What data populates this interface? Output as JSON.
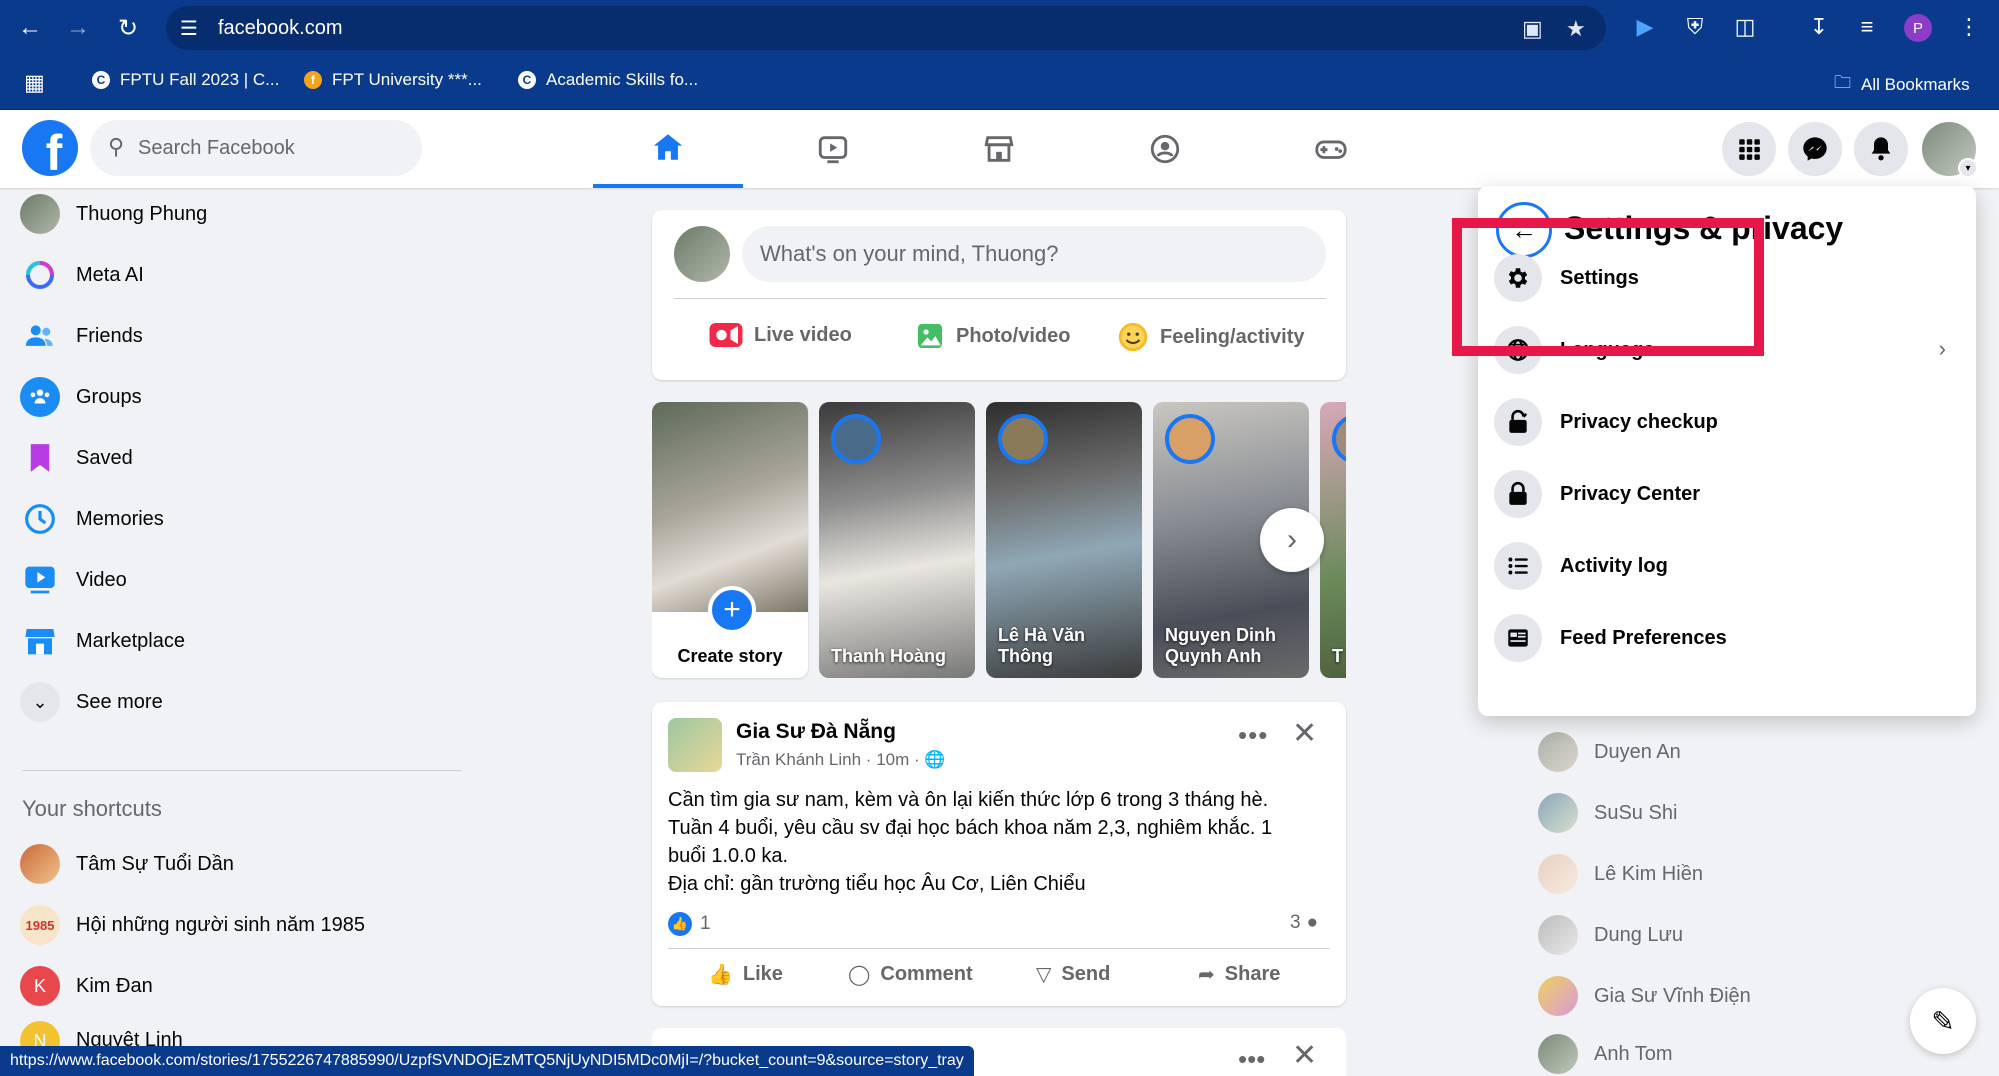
{
  "browser": {
    "url": "facebook.com",
    "profile_initial": "P",
    "bookmarks": [
      {
        "label": "FPTU Fall 2023 | C..."
      },
      {
        "label": "FPT University ***..."
      },
      {
        "label": "Academic Skills fo..."
      }
    ],
    "all_bookmarks": "All Bookmarks",
    "status_url": "https://www.facebook.com/stories/1755226747885990/UzpfSVNDOjEzMTQ5NjUyNDI5MDc0MjI=/?bucket_count=9&source=story_tray"
  },
  "header": {
    "search_placeholder": "Search Facebook",
    "logo_letter": "f"
  },
  "sidebar": {
    "items": [
      {
        "label": "Thuong Phung"
      },
      {
        "label": "Meta AI"
      },
      {
        "label": "Friends"
      },
      {
        "label": "Groups"
      },
      {
        "label": "Saved"
      },
      {
        "label": "Memories"
      },
      {
        "label": "Video"
      },
      {
        "label": "Marketplace"
      },
      {
        "label": "See more"
      }
    ],
    "shortcuts_heading": "Your shortcuts",
    "shortcuts": [
      {
        "label": "Tâm Sự Tuổi Dần"
      },
      {
        "label": "Hội những người sinh năm 1985",
        "badge": "1985"
      },
      {
        "label": "Kim Đan",
        "initial": "K"
      },
      {
        "label": "Nguyệt Linh",
        "initial": "N"
      }
    ]
  },
  "composer": {
    "placeholder": "What's on your mind, Thuong?",
    "actions": [
      {
        "label": "Live video"
      },
      {
        "label": "Photo/video"
      },
      {
        "label": "Feeling/activity"
      }
    ]
  },
  "stories": {
    "create_label": "Create story",
    "items": [
      {
        "name": "Thanh Hoàng"
      },
      {
        "name": "Lê Hà Văn Thông"
      },
      {
        "name": "Nguyen Dinh Quynh Anh"
      },
      {
        "name": "T T"
      }
    ]
  },
  "post": {
    "title": "Gia Sư Đà Nẵng",
    "author": "Trần Khánh Linh",
    "time": "10m",
    "lines": [
      "Cần tìm gia sư nam, kèm và ôn lại kiến thức lớp 6 trong 3 tháng hè.",
      "Tuần 4 buổi, yêu cầu sv đại học bách khoa năm 2,3, nghiêm khắc. 1",
      "buổi 1.0.0 ka.",
      "Địa chỉ: gần trường tiểu học Âu Cơ, Liên Chiểu"
    ],
    "likes": "1",
    "comments": "3",
    "actions": [
      {
        "label": "Like"
      },
      {
        "label": "Comment"
      },
      {
        "label": "Send"
      },
      {
        "label": "Share"
      }
    ]
  },
  "contacts": [
    {
      "name": "Duyen An"
    },
    {
      "name": "SuSu Shi"
    },
    {
      "name": "Lê Kim Hiền"
    },
    {
      "name": "Dung Lưu"
    },
    {
      "name": "Gia Sư Vĩnh Điện"
    },
    {
      "name": "Anh Tom"
    }
  ],
  "dropdown": {
    "title": "Settings & privacy",
    "items": [
      {
        "label": "Settings"
      },
      {
        "label": "Language"
      },
      {
        "label": "Privacy checkup"
      },
      {
        "label": "Privacy Center"
      },
      {
        "label": "Activity log"
      },
      {
        "label": "Feed Preferences"
      }
    ]
  },
  "colors": {
    "brand": "#1877f2",
    "highlight": "#e8174a",
    "browser": "#0a3a8c"
  }
}
